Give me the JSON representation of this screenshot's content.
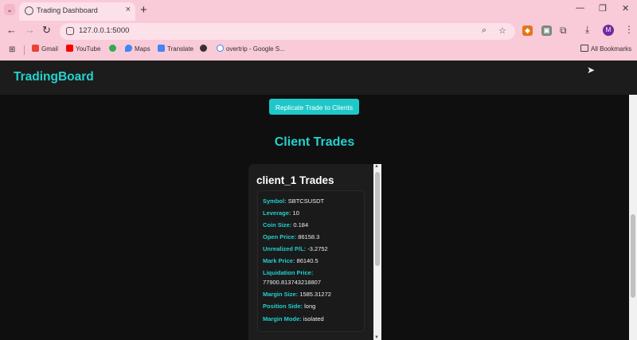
{
  "browser": {
    "tab_title": "Trading Dashboard",
    "url": "127.0.0.1:5000",
    "profile_initial": "M",
    "bookmarks": [
      {
        "label": "Gmail",
        "icon": "gmail-icon",
        "color": "#ea4335"
      },
      {
        "label": "YouTube",
        "icon": "youtube-icon",
        "color": "#ff0000"
      },
      {
        "label": "",
        "icon": "green-app-icon",
        "color": "#34a853"
      },
      {
        "label": "Maps",
        "icon": "maps-icon",
        "color": "#4285f4"
      },
      {
        "label": "Translate",
        "icon": "translate-icon",
        "color": "#4285f4"
      },
      {
        "label": "",
        "icon": "globe-icon",
        "color": "#333333"
      },
      {
        "label": "overtrip - Google S...",
        "icon": "google-icon",
        "color": "#4285f4"
      }
    ],
    "all_bookmarks_label": "All Bookmarks"
  },
  "app": {
    "brand": "TradingBoard",
    "replicate_button": "Replicate Trade to Clients",
    "section_title": "Client Trades",
    "accent_color": "#22d3cf"
  },
  "trades_panel": {
    "title": "client_1 Trades",
    "fields": [
      {
        "label": "Symbol:",
        "value": "SBTCSUSDT"
      },
      {
        "label": "Leverage:",
        "value": "10"
      },
      {
        "label": "Coin Size:",
        "value": "0.184"
      },
      {
        "label": "Open Price:",
        "value": "86158.3"
      },
      {
        "label": "Unrealized P/L:",
        "value": "-3.2752"
      },
      {
        "label": "Mark Price:",
        "value": "86140.5"
      },
      {
        "label": "Liquidation Price:",
        "value": "77900.813743218807"
      },
      {
        "label": "Margin Size:",
        "value": "1585.31272"
      },
      {
        "label": "Position Side:",
        "value": "long"
      },
      {
        "label": "Margin Mode:",
        "value": "isolated"
      }
    ]
  }
}
